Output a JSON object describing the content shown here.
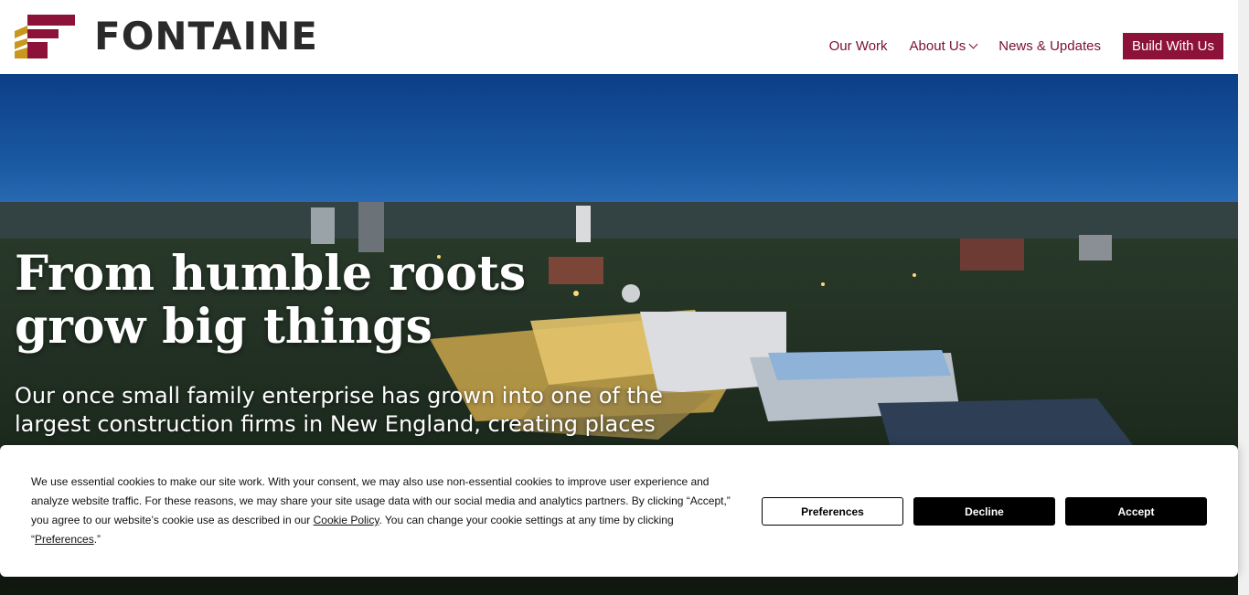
{
  "header": {
    "brand": "FONTAINE",
    "nav": [
      {
        "label": "Our Work"
      },
      {
        "label": "About Us"
      },
      {
        "label": "News & Updates"
      }
    ],
    "cta_label": "Build With Us"
  },
  "hero": {
    "title_line1": "From humble roots",
    "title_line2": "grow big things",
    "subtitle": "Our once small family enterprise has grown into one of the largest construction firms in New England, creating places"
  },
  "cookie_banner": {
    "text_before_policy": "We use essential cookies to make our site work. With your consent, we may also use non-essential cookies to improve user experience and analyze website traffic. For these reasons, we may share your site usage data with our social media and analytics partners. By clicking “Accept,” you agree to our website’s cookie use as described in our ",
    "policy_link": "Cookie Policy",
    "text_after_policy": ". You can change your cookie settings at any time by clicking “",
    "preferences_link": "Preferences",
    "text_end": ".”",
    "buttons": {
      "preferences": "Preferences",
      "decline": "Decline",
      "accept": "Accept"
    }
  },
  "colors": {
    "brand_maroon": "#8c1239",
    "brand_gold": "#c9961e",
    "nav_text": "#7a1032"
  }
}
